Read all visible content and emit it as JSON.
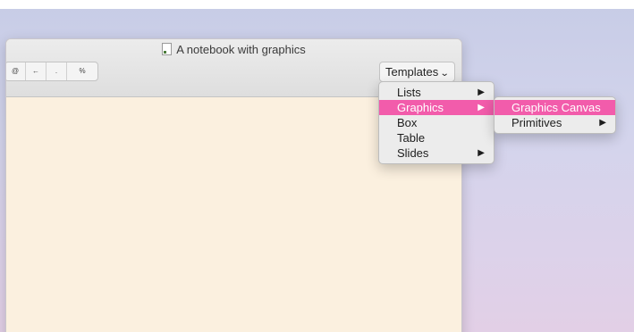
{
  "window": {
    "title": "A notebook with graphics"
  },
  "toolbar": {
    "buttons": [
      "@",
      "←",
      ".",
      "%"
    ],
    "templates_label": "Templates"
  },
  "menu": {
    "items": [
      {
        "label": "Lists",
        "submenu": true
      },
      {
        "label": "Graphics",
        "submenu": true,
        "highlighted": true
      },
      {
        "label": "Box",
        "submenu": false
      },
      {
        "label": "Table",
        "submenu": false
      },
      {
        "label": "Slides",
        "submenu": true
      }
    ],
    "arrow_glyph": "▶"
  },
  "submenu": {
    "items": [
      {
        "label": "Graphics Canvas",
        "submenu": false,
        "highlighted": true
      },
      {
        "label": "Primitives",
        "submenu": true
      }
    ]
  },
  "colors": {
    "highlight": "#f25cab",
    "notebook_bg": "#fbf0df"
  },
  "icons": {
    "title_icon": "document-icon",
    "templates_icon": "chevron-down-icon"
  }
}
